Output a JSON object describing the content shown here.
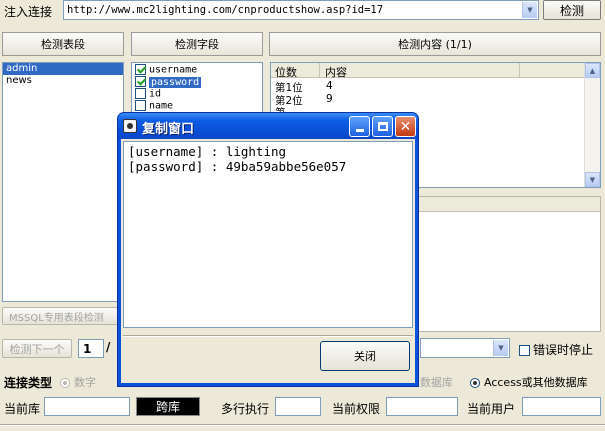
{
  "top": {
    "inject_label": "注入连接",
    "url_value": "http://www.mc2lighting.com/cnproductshow.asp?id=17",
    "detect_button": "检测"
  },
  "tables": {
    "header": "检测表段",
    "items": [
      "admin",
      "news"
    ]
  },
  "fields": {
    "header": "检测字段",
    "items": [
      {
        "name": "username",
        "checked": true
      },
      {
        "name": "password",
        "checked": true
      },
      {
        "name": "id",
        "checked": false
      },
      {
        "name": "name",
        "checked": false
      }
    ]
  },
  "content": {
    "header": "检测内容 (1/1)",
    "col_pos": "位数",
    "col_content": "内容",
    "rows": [
      {
        "pos": "第1位",
        "val": "4"
      },
      {
        "pos": "第2位",
        "val": "9"
      },
      {
        "pos": "第",
        "val": ""
      }
    ]
  },
  "mssql_button": "MSSQL专用表段检测",
  "next_button": "检测下一个",
  "page_value": "1",
  "page_sep": "/",
  "pause_on_error": "错误时停止",
  "conn": {
    "label": "连接类型",
    "numeric": "数字",
    "db_fragment": "数据库",
    "access": "Access或其他数据库"
  },
  "bottom": {
    "current_db": "当前库",
    "cross_db": "跨库",
    "multi_exec": "多行执行",
    "current_perm": "当前权限",
    "current_user": "当前用户"
  },
  "dialog": {
    "title": "复制窗口",
    "text": "[username] : lighting\n[password] : 49ba59abbe56e057\n\n",
    "close_button": "关闭"
  },
  "icons": {
    "dropdown": "chevron-down-icon",
    "minimize": "minimize-icon",
    "maximize": "maximize-icon",
    "close": "close-icon"
  }
}
